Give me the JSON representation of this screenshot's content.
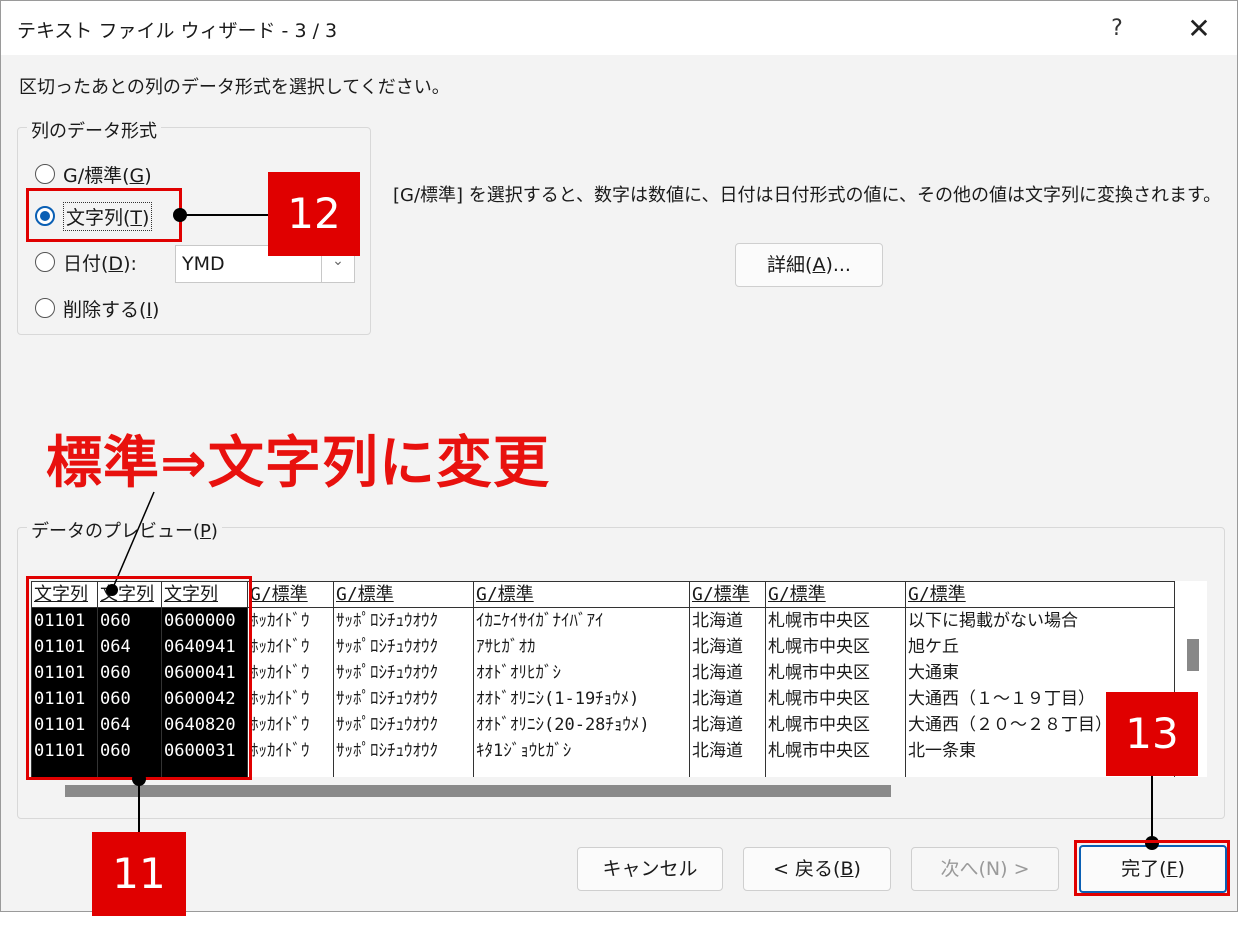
{
  "dialog": {
    "title": "テキスト ファイル ウィザード - 3 / 3",
    "help_icon": "?",
    "close_icon": "✕",
    "instruction": "区切ったあとの列のデータ形式を選択してください。"
  },
  "format_group": {
    "label": "列のデータ形式",
    "options": [
      {
        "text": "G/標準(",
        "key": "G",
        "suffix": ")"
      },
      {
        "text": "文字列(",
        "key": "T",
        "suffix": ")"
      },
      {
        "text": "日付(",
        "key": "D",
        "suffix": "):"
      },
      {
        "text": "削除する(",
        "key": "I",
        "suffix": ")"
      }
    ],
    "selected": "文字列",
    "date_value": "YMD"
  },
  "description": "[G/標準] を選択すると、数字は数値に、日付は日付形式の値に、その他の値は文字列に変換されます。",
  "detail_button": {
    "text": "詳細(",
    "key": "A",
    "suffix": ")..."
  },
  "annotations": {
    "main_text": "標準⇒文字列に変更",
    "num_11": "11",
    "num_12": "12",
    "num_13": "13"
  },
  "preview": {
    "label_text": "データのプレビュー(",
    "label_key": "P",
    "label_suffix": ")",
    "columns": [
      {
        "header": "文字列",
        "selected": true,
        "cells": [
          "01101",
          "01101",
          "01101",
          "01101",
          "01101",
          "01101"
        ]
      },
      {
        "header": "文字列",
        "selected": true,
        "cells": [
          "060",
          "064",
          "060",
          "060",
          "064",
          "060"
        ]
      },
      {
        "header": "文字列",
        "selected": true,
        "cells": [
          "0600000",
          "0640941",
          "0600041",
          "0600042",
          "0640820",
          "0600031"
        ]
      },
      {
        "header": "G/標準",
        "selected": false,
        "cells": [
          "ﾎｯｶｲﾄﾞｳ",
          "ﾎｯｶｲﾄﾞｳ",
          "ﾎｯｶｲﾄﾞｳ",
          "ﾎｯｶｲﾄﾞｳ",
          "ﾎｯｶｲﾄﾞｳ",
          "ﾎｯｶｲﾄﾞｳ"
        ]
      },
      {
        "header": "G/標準",
        "selected": false,
        "cells": [
          "ｻｯﾎﾟﾛｼﾁｭｳｵｳｸ",
          "ｻｯﾎﾟﾛｼﾁｭｳｵｳｸ",
          "ｻｯﾎﾟﾛｼﾁｭｳｵｳｸ",
          "ｻｯﾎﾟﾛｼﾁｭｳｵｳｸ",
          "ｻｯﾎﾟﾛｼﾁｭｳｵｳｸ",
          "ｻｯﾎﾟﾛｼﾁｭｳｵｳｸ"
        ]
      },
      {
        "header": "G/標準",
        "selected": false,
        "cells": [
          "ｲｶﾆｹｲｻｲｶﾞﾅｲﾊﾞｱｲ",
          "ｱｻﾋｶﾞｵｶ",
          "ｵｵﾄﾞｵﾘﾋｶﾞｼ",
          "ｵｵﾄﾞｵﾘﾆｼ(1-19ﾁｮｳﾒ)",
          "ｵｵﾄﾞｵﾘﾆｼ(20-28ﾁｮｳﾒ)",
          "ｷﾀ1ｼﾞｮｳﾋｶﾞｼ"
        ]
      },
      {
        "header": "G/標準",
        "selected": false,
        "cells": [
          "北海道",
          "北海道",
          "北海道",
          "北海道",
          "北海道",
          "北海道"
        ]
      },
      {
        "header": "G/標準",
        "selected": false,
        "cells": [
          "札幌市中央区",
          "札幌市中央区",
          "札幌市中央区",
          "札幌市中央区",
          "札幌市中央区",
          "札幌市中央区"
        ]
      },
      {
        "header": "G/標準",
        "selected": false,
        "cells": [
          "以下に掲載がない場合",
          "旭ケ丘",
          "大通東",
          "大通西（１～１９丁目）",
          "大通西（２０～２８丁目）",
          "北一条東"
        ]
      }
    ]
  },
  "buttons": {
    "cancel": "キャンセル",
    "back": {
      "text": "< 戻る(",
      "key": "B",
      "suffix": ")"
    },
    "next": "次へ(N) >",
    "finish": {
      "text": "完了(",
      "key": "F",
      "suffix": ")"
    }
  },
  "colors": {
    "annotation_red": "#e00000",
    "accent_blue": "#0a5fb4"
  }
}
